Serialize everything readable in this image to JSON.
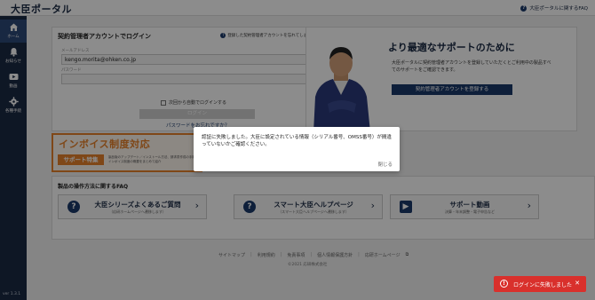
{
  "app": {
    "logo": "大臣ポータル"
  },
  "header": {
    "faq_link": "大臣ポータルに関するFAQ"
  },
  "sidebar": {
    "items": [
      {
        "label": "ホーム",
        "icon": "home-icon"
      },
      {
        "label": "お知らせ",
        "icon": "bell-icon"
      },
      {
        "label": "動画",
        "icon": "video-icon"
      },
      {
        "label": "各種手続",
        "icon": "gear-icon"
      }
    ],
    "version": "ver 1.3.1"
  },
  "login": {
    "title": "契約管理者アカウントでログイン",
    "forgot_account_link": "登録した契約管理者アカウントを忘れてしまった",
    "email_label": "メールアドレス",
    "email_value": "kengo.morita@ohken.co.jp",
    "password_label": "パスワード",
    "password_value": "",
    "remember_label": "次回から自動でログインする",
    "login_button": "ログイン",
    "forgot_password_link": "パスワードをお忘れですか？"
  },
  "promo": {
    "title": "より最適なサポートのために",
    "description": "大臣ポータルに契約管理者アカウントを登録していただくとご利用中の製品すべてのサポートをご確認できます。",
    "register_button": "契約管理者アカウントを登録する"
  },
  "invoice_banner": {
    "title": "インボイス制度対応",
    "subtitle": "サポート特集",
    "note": "製品版のアップデート／インストール方法、請求書作成の手順、インボイス制度の概要をまとめて紹介"
  },
  "faq": {
    "title": "製品の操作方法に関するFAQ",
    "buttons": [
      {
        "label": "大臣シリーズよくあるご質問",
        "sub": "（応研ホームページへ遷移します）",
        "icon": "question-circle-icon"
      },
      {
        "label": "スマート大臣ヘルプページ",
        "sub": "（スマート大臣ヘルプページへ遷移します）",
        "icon": "question-circle-icon"
      },
      {
        "label": "サポート動画",
        "sub": "決算・年末調整・電子申告など",
        "icon": "video-icon"
      }
    ]
  },
  "footer": {
    "links": [
      "サイトマップ",
      "利用規約",
      "免責事項",
      "個人情報保護方針",
      "応研ホームページ"
    ],
    "copyright": "©2021 応研株式会社"
  },
  "dialog": {
    "message": "認証に失敗しました。大臣に設定されている情報（シリアル番号、OMSS番号）が間違っていないかご確認ください。",
    "close": "閉じる"
  },
  "toast": {
    "message": "ログインに失敗しました",
    "color": "#d9302c"
  }
}
